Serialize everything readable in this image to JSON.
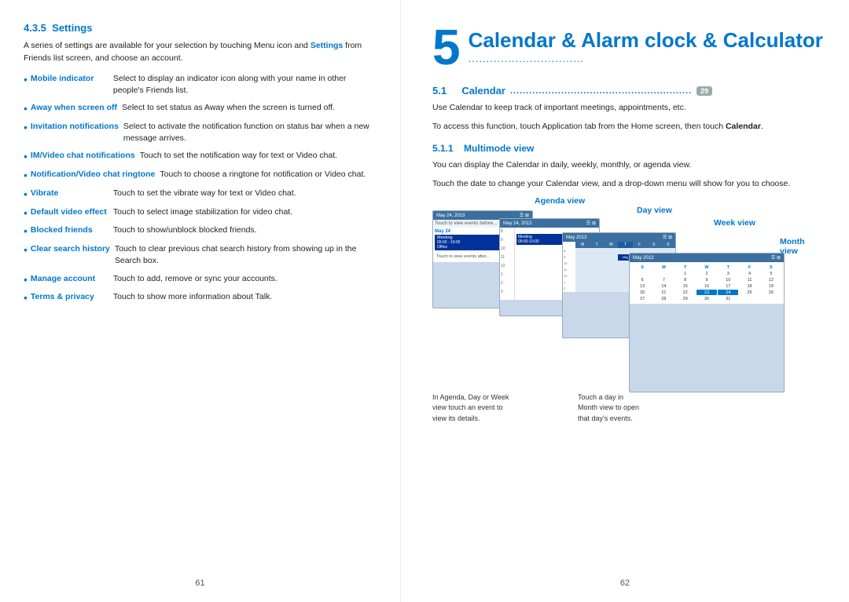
{
  "left_page": {
    "section_number": "4.3.5",
    "section_title": "Settings",
    "intro": "A series of settings are available for your selection by touching Menu icon",
    "intro2": " and ",
    "intro_bold": "Settings",
    "intro3": " from Friends list screen, and choose an account.",
    "items": [
      {
        "term": "Mobile indicator",
        "desc": "Select to display an indicator icon along with your name in other people's Friends list."
      },
      {
        "term": "Away when screen off",
        "desc": "Select to set status as Away when the screen is turned off."
      },
      {
        "term": "Invitation notifications",
        "desc": "Select to activate the notification function on status bar when a new message arrives."
      },
      {
        "term": "IM/Video chat notifications",
        "desc": "Touch to set the notification way for text or Video chat."
      },
      {
        "term": "Notification/Video chat ringtone",
        "desc": "Touch to choose a ringtone for notification or Video chat."
      },
      {
        "term": "Vibrate",
        "desc": "Touch to set the vibrate way for text or Video chat."
      },
      {
        "term": "Default video effect",
        "desc": "Touch to select image stabilization for video chat."
      },
      {
        "term": "Blocked friends",
        "desc": "Touch to show/unblock blocked friends."
      },
      {
        "term": "Clear search history",
        "desc": "Touch to clear previous chat search history from showing up in the Search box."
      },
      {
        "term": "Manage account",
        "desc": "Touch to add, remove or sync your accounts."
      },
      {
        "term": "Terms & privacy",
        "desc": "Touch to show more information about Talk."
      }
    ],
    "page_number": "61"
  },
  "right_page": {
    "chapter_number": "5",
    "chapter_title": "Calendar & Alarm clock & Calculator",
    "chapter_dots": "................................",
    "section_5_1_number": "5.1",
    "section_5_1_title": "Calendar",
    "section_5_1_dots": ".......................................................",
    "calendar_badge": "29",
    "para1": "Use Calendar to keep track of important meetings, appointments, etc.",
    "para2": "To access this function, touch Application tab from the Home screen, then touch ",
    "para2_bold": "Calendar",
    "para2_end": ".",
    "section_5_1_1_number": "5.1.1",
    "section_5_1_1_title": "Multimode view",
    "para3": "You can display the Calendar in daily, weekly, monthly, or agenda view.",
    "para4": "Touch the date to change your Calendar view, and a drop-down menu will show for you to choose.",
    "agenda_label": "Agenda view",
    "day_label": "Day view",
    "week_label": "Week view",
    "month_label": "Month view",
    "caption1": "In Agenda, Day or Week",
    "caption2": "view touch an event to",
    "caption3": "view its details.",
    "caption4": "Touch a day in",
    "caption5": "Month view to open",
    "caption6": "that day's events.",
    "page_number": "62",
    "may_date": "May 24, 2013",
    "may_month": "May 2013"
  }
}
